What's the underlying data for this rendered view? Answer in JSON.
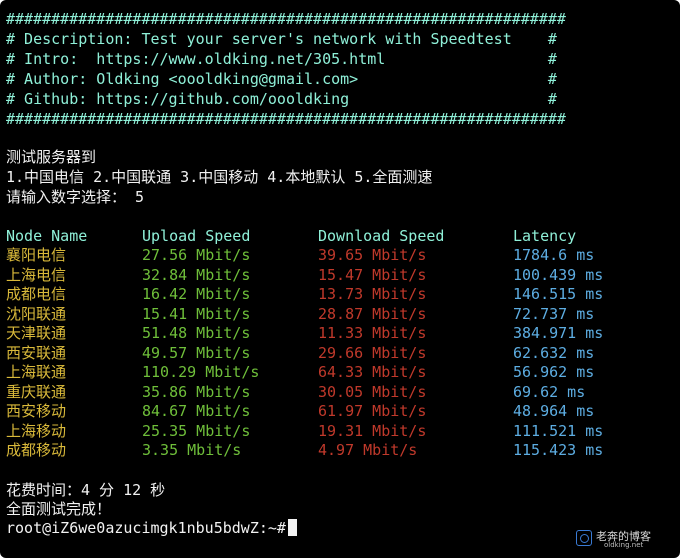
{
  "banner": {
    "hash_line": "##############################################################",
    "lines": [
      "# Description: Test your server's network with Speedtest    #",
      "# Intro:  https://www.oldking.net/305.html                  #",
      "# Author: Oldking <oooldking@gmail.com>                     #",
      "# Github: https://github.com/oooldking                      #"
    ]
  },
  "menu": {
    "title": "测试服务器到",
    "options": "1.中国电信 2.中国联通 3.中国移动 4.本地默认 5.全面测速",
    "prompt": "请输入数字选择： 5"
  },
  "table": {
    "headers": {
      "node": "Node Name",
      "upload": "Upload Speed",
      "download": "Download Speed",
      "latency": "Latency"
    },
    "rows": [
      {
        "node": "襄阳电信",
        "upload": "27.56 Mbit/s",
        "download": "39.65 Mbit/s",
        "latency": "1784.6 ms"
      },
      {
        "node": "上海电信",
        "upload": "32.84 Mbit/s",
        "download": "15.47 Mbit/s",
        "latency": "100.439 ms"
      },
      {
        "node": "成都电信",
        "upload": "16.42 Mbit/s",
        "download": "13.73 Mbit/s",
        "latency": "146.515 ms"
      },
      {
        "node": "沈阳联通",
        "upload": "15.41 Mbit/s",
        "download": "28.87 Mbit/s",
        "latency": "72.737 ms"
      },
      {
        "node": "天津联通",
        "upload": "51.48 Mbit/s",
        "download": "11.33 Mbit/s",
        "latency": "384.971 ms"
      },
      {
        "node": "西安联通",
        "upload": "49.57 Mbit/s",
        "download": "29.66 Mbit/s",
        "latency": "62.632 ms"
      },
      {
        "node": "上海联通",
        "upload": "110.29 Mbit/s",
        "download": "64.33 Mbit/s",
        "latency": "56.962 ms"
      },
      {
        "node": "重庆联通",
        "upload": "35.86 Mbit/s",
        "download": "30.05 Mbit/s",
        "latency": "69.62 ms"
      },
      {
        "node": "西安移动",
        "upload": "84.67 Mbit/s",
        "download": "61.97 Mbit/s",
        "latency": "48.964 ms"
      },
      {
        "node": "上海移动",
        "upload": "25.35 Mbit/s",
        "download": "19.31 Mbit/s",
        "latency": "111.521 ms"
      },
      {
        "node": "成都移动",
        "upload": "3.35 Mbit/s",
        "download": "4.97 Mbit/s",
        "latency": "115.423 ms"
      }
    ]
  },
  "footer": {
    "elapsed": "花费时间：4 分 12 秒",
    "done": "全面测试完成！",
    "shell_prompt": "root@iZ6we0azucimgk1nbu5bdwZ:~#"
  },
  "watermark": {
    "title": "老奔的博客",
    "subtitle": "oldking.net"
  },
  "colors": {
    "background": "#000000",
    "banner": "#8ff0d8",
    "node": "#d9b93a",
    "upload": "#6fbf3a",
    "download": "#c0392b",
    "latency": "#5dade2"
  }
}
